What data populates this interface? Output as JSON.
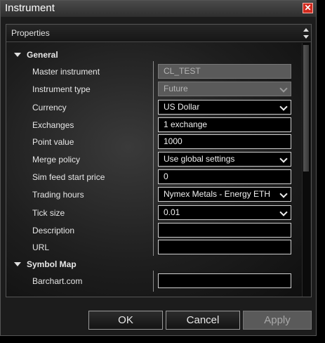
{
  "window": {
    "title": "Instrument",
    "close_glyph": "✕"
  },
  "panel": {
    "title": "Properties"
  },
  "sections": {
    "general": "General",
    "symbol_map": "Symbol Map"
  },
  "fields": {
    "master_instrument": {
      "label": "Master instrument",
      "value": "CL_TEST"
    },
    "instrument_type": {
      "label": "Instrument type",
      "value": "Future"
    },
    "currency": {
      "label": "Currency",
      "value": "US Dollar"
    },
    "exchanges": {
      "label": "Exchanges",
      "value": "1 exchange"
    },
    "point_value": {
      "label": "Point value",
      "value": "1000"
    },
    "merge_policy": {
      "label": "Merge policy",
      "value": "Use global settings"
    },
    "sim_feed_start_price": {
      "label": "Sim feed start price",
      "value": "0"
    },
    "trading_hours": {
      "label": "Trading hours",
      "value": "Nymex Metals - Energy ETH"
    },
    "tick_size": {
      "label": "Tick size",
      "value": "0.01"
    },
    "description": {
      "label": "Description",
      "value": ""
    },
    "url": {
      "label": "URL",
      "value": ""
    },
    "barchart": {
      "label": "Barchart.com",
      "value": ""
    }
  },
  "buttons": {
    "ok": "OK",
    "cancel": "Cancel",
    "apply": "Apply"
  },
  "colors": {
    "close_button": "#d12a1e",
    "background": "#1c1c1c"
  }
}
